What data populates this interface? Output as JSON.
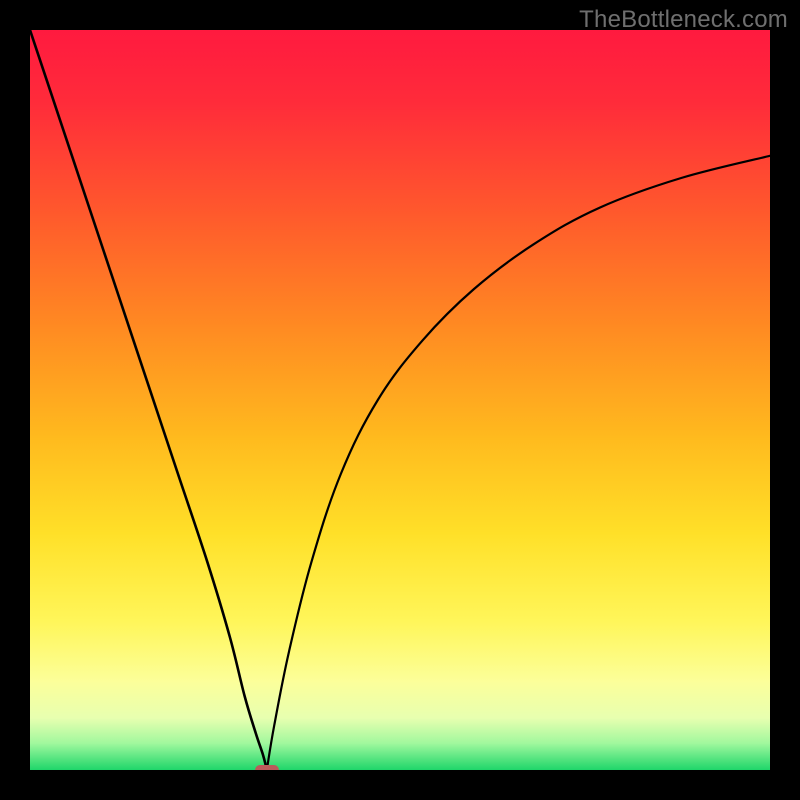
{
  "watermark": "TheBottleneck.com",
  "chart_data": {
    "type": "line",
    "title": "",
    "xlabel": "",
    "ylabel": "",
    "xlim": [
      0,
      100
    ],
    "ylim": [
      0,
      100
    ],
    "grid": false,
    "annotations": [],
    "background_gradient": {
      "description": "vertical gradient from red (top) through orange, yellow, pale yellow to green (bottom)",
      "stops": [
        {
          "pos": 0.0,
          "color": "#ff1a3f"
        },
        {
          "pos": 0.1,
          "color": "#ff2c3a"
        },
        {
          "pos": 0.25,
          "color": "#ff5a2c"
        },
        {
          "pos": 0.4,
          "color": "#ff8a22"
        },
        {
          "pos": 0.55,
          "color": "#ffba1e"
        },
        {
          "pos": 0.68,
          "color": "#ffe028"
        },
        {
          "pos": 0.8,
          "color": "#fff65a"
        },
        {
          "pos": 0.88,
          "color": "#fcff9a"
        },
        {
          "pos": 0.93,
          "color": "#e7ffb0"
        },
        {
          "pos": 0.965,
          "color": "#9cf79c"
        },
        {
          "pos": 1.0,
          "color": "#1fd66a"
        }
      ]
    },
    "series": [
      {
        "name": "left-branch",
        "x": [
          0,
          4,
          8,
          12,
          16,
          20,
          24,
          27,
          29,
          30.5,
          31.5,
          32
        ],
        "y": [
          100,
          88,
          76,
          64,
          52,
          40,
          28,
          18,
          10,
          5,
          2,
          0
        ]
      },
      {
        "name": "right-branch",
        "x": [
          32,
          33,
          35,
          38,
          42,
          47,
          53,
          60,
          68,
          77,
          88,
          100
        ],
        "y": [
          0,
          6,
          16,
          28,
          40,
          50,
          58,
          65,
          71,
          76,
          80,
          83
        ]
      }
    ],
    "marker": {
      "name": "minimum-marker",
      "x": 32,
      "y": 0,
      "width_frac": 0.032,
      "height_frac": 0.014,
      "color": "#bb5b5b"
    }
  }
}
